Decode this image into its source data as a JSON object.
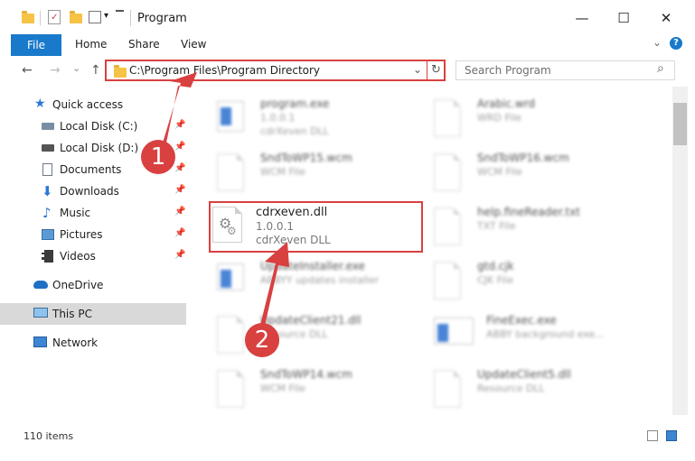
{
  "window": {
    "title": "Program",
    "minimize_glyph": "—",
    "maximize_glyph": "☐",
    "close_glyph": "✕",
    "quick_access_dropdown": "▾",
    "help_glyph": "?",
    "ribbon_expand_glyph": "⌄"
  },
  "ribbon": {
    "tabs": [
      {
        "label": "File"
      },
      {
        "label": "Home"
      },
      {
        "label": "Share"
      },
      {
        "label": "View"
      }
    ]
  },
  "navigation": {
    "back": "←",
    "forward": "→",
    "recent": "⌄",
    "up": "↑",
    "address": "C:\\Program Files\\Program Directory",
    "address_dropdown": "⌄",
    "refresh": "↻",
    "search_placeholder": "Search Program",
    "search_icon": "⌕"
  },
  "sidebar": {
    "pin_glyph": "📌",
    "items": [
      {
        "label": "Quick access",
        "icon": "star-icon"
      },
      {
        "label": "Local Disk (C:)",
        "icon": "disk-icon",
        "pinned": true
      },
      {
        "label": "Local Disk (D:)",
        "icon": "disk-icon",
        "pinned": true
      },
      {
        "label": "Documents",
        "icon": "documents-icon",
        "pinned": true
      },
      {
        "label": "Downloads",
        "icon": "download-icon",
        "pinned": true
      },
      {
        "label": "Music",
        "icon": "music-icon",
        "pinned": true
      },
      {
        "label": "Pictures",
        "icon": "pictures-icon",
        "pinned": true
      },
      {
        "label": "Videos",
        "icon": "videos-icon",
        "pinned": true
      },
      {
        "label": "OneDrive",
        "icon": "cloud-icon"
      },
      {
        "label": "This PC",
        "icon": "computer-icon",
        "selected": true
      },
      {
        "label": "Network",
        "icon": "network-icon"
      }
    ]
  },
  "files": [
    {
      "name": "program.exe",
      "line2": "1.0.0.1",
      "line3": "cdrXeven DLL"
    },
    {
      "name": "Arabic.wrd",
      "line2": "WRD File",
      "line3": ""
    },
    {
      "name": "SndToWP15.wcm",
      "line2": "WCM File",
      "line3": ""
    },
    {
      "name": "SndToWP16.wcm",
      "line2": "WCM File",
      "line3": ""
    },
    {
      "name": "cdrxeven.dll",
      "line2": "1.0.0.1",
      "line3": "cdrXeven DLL",
      "highlighted": true
    },
    {
      "name": "help.fineReader.txt",
      "line2": "TXT File",
      "line3": ""
    },
    {
      "name": "UpdateInstaller.exe",
      "line2": "ABBYY updates installer",
      "line3": ""
    },
    {
      "name": "gtd.cjk",
      "line2": "CJK File",
      "line3": ""
    },
    {
      "name": "UpdateClient21.dll",
      "line2": "Resource DLL",
      "line3": ""
    },
    {
      "name": "FineExec.exe",
      "line2": "ABBY background exe...",
      "line3": ""
    },
    {
      "name": "SndToWP14.wcm",
      "line2": "WCM File",
      "line3": ""
    },
    {
      "name": "UpdateClient5.dll",
      "line2": "Resource DLL",
      "line3": ""
    }
  ],
  "status": {
    "item_count": "110 items"
  },
  "callouts": [
    {
      "label": "1"
    },
    {
      "label": "2"
    }
  ],
  "colors": {
    "accent": "#1979ca",
    "highlight_red": "#d94040",
    "selected_bg": "#d9d9d9"
  }
}
